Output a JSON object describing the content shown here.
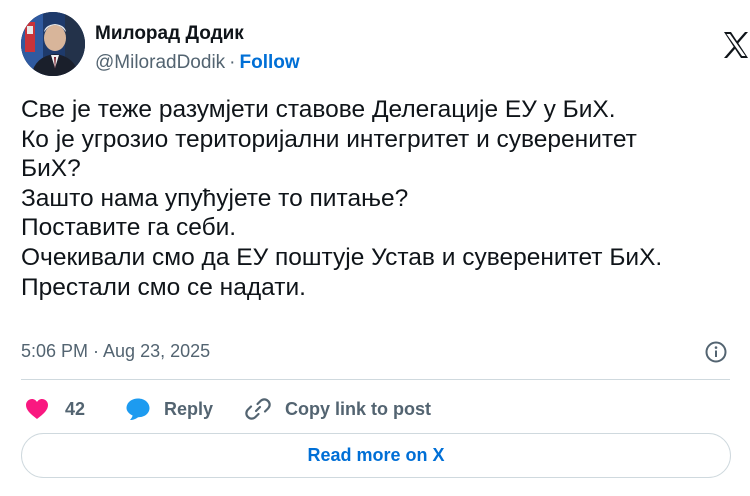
{
  "author": {
    "display_name": "Милорад Додик",
    "handle": "@MiloradDodik",
    "separator": "·",
    "follow_label": "Follow"
  },
  "post": {
    "lines": [
      "Све је теже разумјети ставове Делегације ЕУ у БиХ.",
      "Ко је угрозио територијални интегритет и суверенитет",
      "БиХ?",
      "Зашто нама упућујете то питање?",
      "Поставите га себи.",
      "Очекивали смо да ЕУ поштује Устав и суверенитет БиХ.",
      "Престали смо се надати."
    ],
    "timestamp": "5:06 PM · Aug 23, 2025"
  },
  "actions": {
    "like_count": "42",
    "reply_label": "Reply",
    "copy_label": "Copy link to post"
  },
  "footer": {
    "read_more_label": "Read more on X"
  },
  "colors": {
    "text": "#0f1419",
    "muted": "#536471",
    "link": "#006fd6",
    "like": "#f91880",
    "reply": "#1d9bf0",
    "border": "#cfd9de"
  },
  "icons": [
    "x-logo-icon",
    "info-icon",
    "heart-icon",
    "reply-bubble-icon",
    "link-icon"
  ]
}
